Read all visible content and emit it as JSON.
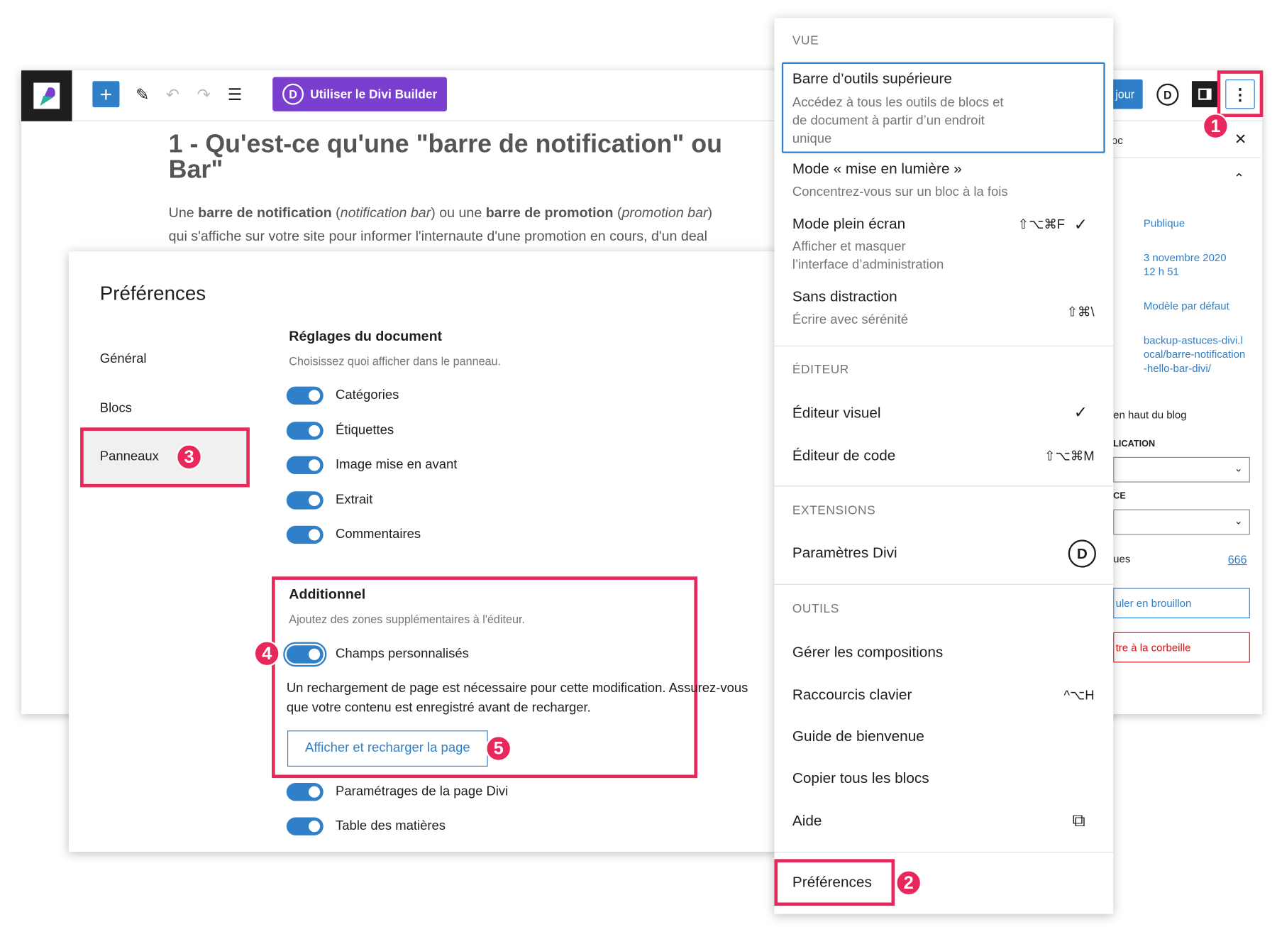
{
  "toolbar": {
    "divi_button": "Utiliser le Divi Builder",
    "divi_letter": "D",
    "update_partial": "jour"
  },
  "post": {
    "title_line1": "1 - Qu'est-ce qu'une \"barre de notification\" ou",
    "title_line2": "Bar\"",
    "para1": [
      {
        "t": "Une ",
        "s": "n"
      },
      {
        "t": "barre de notification",
        "s": "b"
      },
      {
        "t": " (",
        "s": "n"
      },
      {
        "t": "notification bar",
        "s": "i"
      },
      {
        "t": ") ou une ",
        "s": "n"
      },
      {
        "t": "barre de promotion",
        "s": "b"
      },
      {
        "t": " (",
        "s": "n"
      },
      {
        "t": "promotion bar",
        "s": "i"
      },
      {
        "t": ")",
        "s": "n"
      }
    ],
    "para2": "qui s'affiche sur votre site pour informer l'internaute d'une promotion en cours, d'un deal"
  },
  "sidebar": {
    "tab_partial": "oc",
    "visibility": "Publique",
    "date": "3 novembre 2020",
    "time": "12 h 51",
    "template": "Modèle par défaut",
    "url": "backup-astuces-divi.local/barre-notification-hello-bar-divi/",
    "sticky_partial": "en haut du blog",
    "pub_label_partial": "LICATION",
    "ce_label_partial": "CE",
    "revisions_partial": "ues",
    "revisions_count": "666",
    "draft_partial": "uler en brouillon",
    "trash_partial": "tre à la corbeille"
  },
  "preferences": {
    "title": "Préférences",
    "nav": [
      "Général",
      "Blocs",
      "Panneaux"
    ],
    "doc_section": {
      "title": "Réglages du document",
      "desc": "Choisissez quoi afficher dans le panneau.",
      "toggles": [
        {
          "label": "Catégories",
          "on": true
        },
        {
          "label": "Étiquettes",
          "on": true
        },
        {
          "label": "Image mise en avant",
          "on": true
        },
        {
          "label": "Extrait",
          "on": true
        },
        {
          "label": "Commentaires",
          "on": true
        }
      ]
    },
    "additional": {
      "title": "Additionnel",
      "desc": "Ajoutez des zones supplémentaires à l'éditeur.",
      "toggle": {
        "label": "Champs personnalisés",
        "on": true
      },
      "notice_line1": "Un rechargement de page est nécessaire pour cette modification. Assurez-vous",
      "notice_line2": "que votre contenu est enregistré avant de recharger.",
      "reload_button": "Afficher et recharger la page"
    },
    "more_toggles": [
      {
        "label": "Paramétrages de la page Divi",
        "on": true
      },
      {
        "label": "Table des matières",
        "on": true
      }
    ]
  },
  "menu": {
    "view_heading": "VUE",
    "view_items": [
      {
        "label": "Barre d’outils supérieure",
        "desc": [
          "Accédez à tous les outils de blocs et",
          "de document à partir d’un endroit",
          "unique"
        ]
      },
      {
        "label": "Mode « mise en lumière »",
        "desc": [
          "Concentrez-vous sur un bloc à la fois"
        ]
      },
      {
        "label": "Mode plein écran",
        "desc": [
          "Afficher et masquer",
          "l’interface d’administration"
        ],
        "shortcut": "⇧⌥⌘F",
        "checked": true
      },
      {
        "label": "Sans distraction",
        "desc": [
          "Écrire avec sérénité"
        ],
        "shortcut": "⇧⌘\\"
      }
    ],
    "editor_heading": "ÉDITEUR",
    "editor_items": [
      {
        "label": "Éditeur visuel",
        "checked": true
      },
      {
        "label": "Éditeur de code",
        "shortcut": "⇧⌥⌘M"
      }
    ],
    "extensions_heading": "EXTENSIONS",
    "extensions_items": [
      {
        "label": "Paramètres Divi",
        "icon": "D"
      }
    ],
    "tools_heading": "OUTILS",
    "tools_items": [
      {
        "label": "Gérer les compositions"
      },
      {
        "label": "Raccourcis clavier",
        "shortcut": "^⌥H"
      },
      {
        "label": "Guide de bienvenue"
      },
      {
        "label": "Copier tous les blocs"
      },
      {
        "label": "Aide",
        "icon": "external-link"
      }
    ],
    "preferences": "Préférences",
    "check": "✓"
  },
  "badges": [
    "1",
    "2",
    "3",
    "4",
    "5"
  ],
  "colors": {
    "accent": "#2f7fc9",
    "divi": "#7b3fd0",
    "highlight": "#e8285b"
  }
}
